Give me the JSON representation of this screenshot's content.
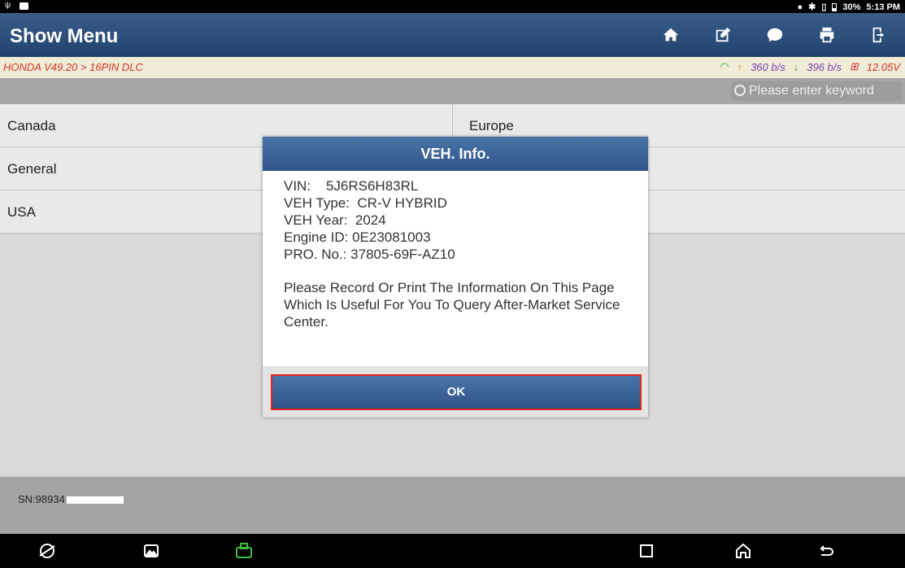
{
  "statusbar": {
    "time": "5:13 PM",
    "battery": "30%"
  },
  "header": {
    "title": "Show Menu"
  },
  "breadcrumb": {
    "path": "HONDA V49.20 > 16PIN DLC",
    "up_rate": "360 b/s",
    "down_rate": "396 b/s",
    "voltage": "12.05V"
  },
  "search": {
    "placeholder": "Please enter keyword"
  },
  "menu": {
    "rows": [
      [
        "Canada",
        "Europe"
      ],
      [
        "General",
        ""
      ],
      [
        "USA",
        ""
      ]
    ]
  },
  "footer": {
    "sn": "SN:98934"
  },
  "dialog": {
    "title": "VEH. Info.",
    "vin": "VIN:    5J6RS6H83RL",
    "veh_type": "VEH Type:  CR-V HYBRID",
    "veh_year": "VEH Year:  2024",
    "engine_id": "Engine ID: 0E23081003",
    "pro_no": "PRO. No.: 37805-69F-AZ10",
    "message": "Please Record Or Print The Information On This Page Which Is Useful For You To Query After-Market Service Center.",
    "ok_label": "OK"
  },
  "colors": {
    "accent": "#2f5487",
    "highlight": "#e2231a"
  }
}
